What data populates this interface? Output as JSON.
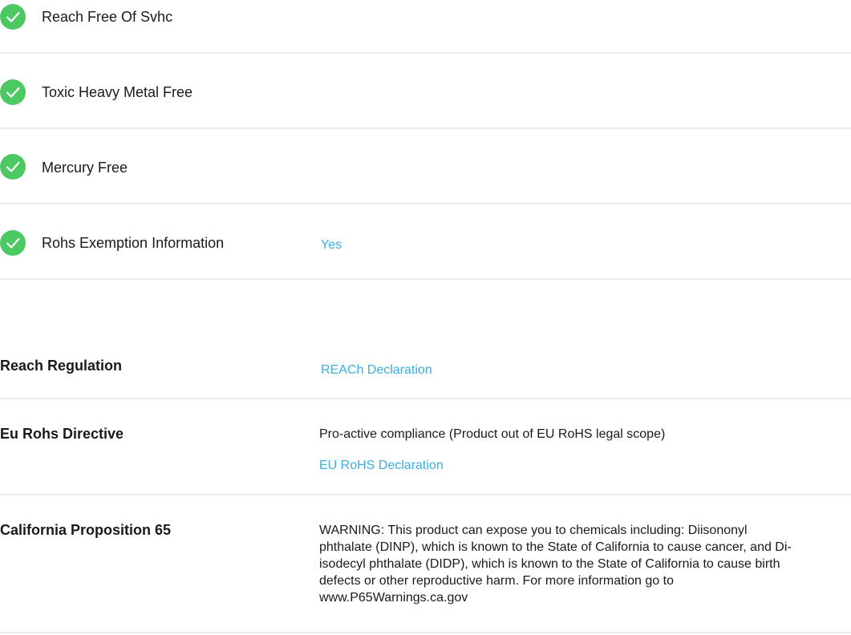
{
  "colors": {
    "check_green": "#4cc963",
    "link_blue": "#3aaee0",
    "divider": "#ececec"
  },
  "compliance_checks": [
    {
      "label": "Reach Free Of Svhc",
      "icon": "check-circle-icon"
    },
    {
      "label": "Toxic Heavy Metal Free",
      "icon": "check-circle-icon"
    },
    {
      "label": "Mercury Free",
      "icon": "check-circle-icon"
    },
    {
      "label": "Rohs Exemption Information",
      "icon": "check-circle-icon",
      "value": "Yes"
    }
  ],
  "regulations": {
    "reach": {
      "label": "Reach Regulation",
      "link": "REACh Declaration"
    },
    "eu_rohs": {
      "label": "Eu Rohs Directive",
      "text": "Pro-active compliance (Product out of EU RoHS legal scope)",
      "link": "EU RoHS Declaration"
    },
    "prop65": {
      "label": "California Proposition 65",
      "lines": [
        "WARNING: This product can expose you to chemicals including: Diisononyl",
        "phthalate (DINP), which is known to the State of California to cause cancer, and Di-",
        "isodecyl phthalate (DIDP), which is known to the State of California to cause birth",
        "defects or other reproductive harm. For more information go to",
        "www.P65Warnings.ca.gov"
      ]
    }
  }
}
